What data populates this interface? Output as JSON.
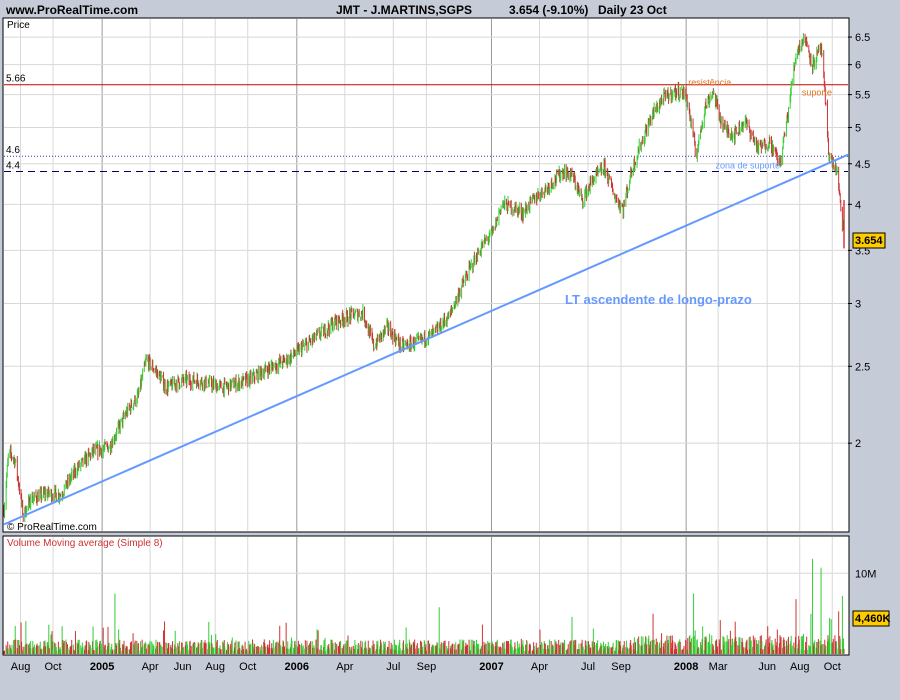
{
  "header": {
    "website": "www.ProRealTime.com",
    "instrument": "JMT - J.MARTINS,SGPS",
    "quote": "3.654 (-9.10%)",
    "period": "Daily 23 Oct"
  },
  "price_panel": {
    "axis_title": "Price",
    "watermark": "© ProRealTime.com",
    "last_price_badge": "3.654"
  },
  "volume_panel": {
    "title": "Volume Moving average (Simple 8)",
    "last_volume_badge": "4,460K"
  },
  "colors": {
    "up": "#33cc33",
    "down": "#cc3333",
    "trendline": "#6699ff",
    "resistance": "#cc0000",
    "support_dotted": "#3333cc",
    "support_dashed": "#000066",
    "annotation_orange": "#e07020"
  },
  "chart_data": [
    {
      "type": "candlestick",
      "scale": "log",
      "ylim": [
        1.55,
        6.85
      ],
      "y_ticks": [
        {
          "value": 6.5,
          "label": "6.5"
        },
        {
          "value": 6,
          "label": "6"
        },
        {
          "value": 5.5,
          "label": "5.5"
        },
        {
          "value": 5,
          "label": "5"
        },
        {
          "value": 4.5,
          "label": "4.5"
        },
        {
          "value": 4,
          "label": "4"
        },
        {
          "value": 3.5,
          "label": "3.5"
        },
        {
          "value": 3,
          "label": "3"
        },
        {
          "value": 2.5,
          "label": "2.5"
        },
        {
          "value": 2,
          "label": "2"
        }
      ],
      "xlim": [
        "2004-07-01",
        "2008-10-23"
      ],
      "x_ticks": [
        {
          "date": "2004-08-01",
          "label": "Aug",
          "major": false
        },
        {
          "date": "2004-10-01",
          "label": "Oct",
          "major": false
        },
        {
          "date": "2005-01-01",
          "label": "2005",
          "major": true
        },
        {
          "date": "2005-04-01",
          "label": "Apr",
          "major": false
        },
        {
          "date": "2005-06-01",
          "label": "Jun",
          "major": false
        },
        {
          "date": "2005-08-01",
          "label": "Aug",
          "major": false
        },
        {
          "date": "2005-10-01",
          "label": "Oct",
          "major": false
        },
        {
          "date": "2006-01-01",
          "label": "2006",
          "major": true
        },
        {
          "date": "2006-04-01",
          "label": "Apr",
          "major": false
        },
        {
          "date": "2006-07-01",
          "label": "Jul",
          "major": false
        },
        {
          "date": "2006-09-01",
          "label": "Sep",
          "major": false
        },
        {
          "date": "2007-01-01",
          "label": "2007",
          "major": true
        },
        {
          "date": "2007-04-01",
          "label": "Apr",
          "major": false
        },
        {
          "date": "2007-07-01",
          "label": "Jul",
          "major": false
        },
        {
          "date": "2007-09-01",
          "label": "Sep",
          "major": false
        },
        {
          "date": "2008-01-01",
          "label": "2008",
          "major": true
        },
        {
          "date": "2008-03-01",
          "label": "Mar",
          "major": false
        },
        {
          "date": "2008-06-01",
          "label": "Jun",
          "major": false
        },
        {
          "date": "2008-08-01",
          "label": "Aug",
          "major": false
        },
        {
          "date": "2008-10-01",
          "label": "Oct",
          "major": false
        }
      ],
      "close_path": [
        {
          "date": "2004-07-01",
          "close": 1.65
        },
        {
          "date": "2004-07-10",
          "close": 1.95
        },
        {
          "date": "2004-07-22",
          "close": 1.9
        },
        {
          "date": "2004-08-06",
          "close": 1.62
        },
        {
          "date": "2004-08-20",
          "close": 1.7
        },
        {
          "date": "2004-09-20",
          "close": 1.73
        },
        {
          "date": "2004-10-15",
          "close": 1.72
        },
        {
          "date": "2004-11-15",
          "close": 1.86
        },
        {
          "date": "2004-12-15",
          "close": 1.95
        },
        {
          "date": "2005-01-15",
          "close": 1.98
        },
        {
          "date": "2005-02-15",
          "close": 2.18
        },
        {
          "date": "2005-03-10",
          "close": 2.3
        },
        {
          "date": "2005-03-25",
          "close": 2.55
        },
        {
          "date": "2005-04-15",
          "close": 2.45
        },
        {
          "date": "2005-05-01",
          "close": 2.35
        },
        {
          "date": "2005-06-01",
          "close": 2.4
        },
        {
          "date": "2005-07-01",
          "close": 2.4
        },
        {
          "date": "2005-08-15",
          "close": 2.35
        },
        {
          "date": "2005-10-01",
          "close": 2.4
        },
        {
          "date": "2005-11-15",
          "close": 2.5
        },
        {
          "date": "2005-12-15",
          "close": 2.55
        },
        {
          "date": "2006-01-15",
          "close": 2.65
        },
        {
          "date": "2006-02-15",
          "close": 2.75
        },
        {
          "date": "2006-03-15",
          "close": 2.85
        },
        {
          "date": "2006-04-15",
          "close": 2.9
        },
        {
          "date": "2006-05-05",
          "close": 2.92
        },
        {
          "date": "2006-05-25",
          "close": 2.65
        },
        {
          "date": "2006-06-20",
          "close": 2.8
        },
        {
          "date": "2006-07-15",
          "close": 2.65
        },
        {
          "date": "2006-08-15",
          "close": 2.68
        },
        {
          "date": "2006-09-15",
          "close": 2.75
        },
        {
          "date": "2006-10-15",
          "close": 2.9
        },
        {
          "date": "2006-11-15",
          "close": 3.25
        },
        {
          "date": "2006-12-15",
          "close": 3.55
        },
        {
          "date": "2007-01-05",
          "close": 3.7
        },
        {
          "date": "2007-01-20",
          "close": 4.0
        },
        {
          "date": "2007-02-15",
          "close": 3.95
        },
        {
          "date": "2007-03-01",
          "close": 3.9
        },
        {
          "date": "2007-03-20",
          "close": 4.05
        },
        {
          "date": "2007-04-15",
          "close": 4.2
        },
        {
          "date": "2007-05-15",
          "close": 4.4
        },
        {
          "date": "2007-06-01",
          "close": 4.35
        },
        {
          "date": "2007-06-20",
          "close": 4.05
        },
        {
          "date": "2007-07-10",
          "close": 4.3
        },
        {
          "date": "2007-08-01",
          "close": 4.45
        },
        {
          "date": "2007-08-20",
          "close": 4.1
        },
        {
          "date": "2007-09-05",
          "close": 3.95
        },
        {
          "date": "2007-09-20",
          "close": 4.4
        },
        {
          "date": "2007-10-10",
          "close": 4.8
        },
        {
          "date": "2007-10-30",
          "close": 5.2
        },
        {
          "date": "2007-11-20",
          "close": 5.45
        },
        {
          "date": "2007-12-15",
          "close": 5.55
        },
        {
          "date": "2008-01-01",
          "close": 5.5
        },
        {
          "date": "2008-01-20",
          "close": 4.6
        },
        {
          "date": "2008-02-05",
          "close": 5.3
        },
        {
          "date": "2008-02-20",
          "close": 5.55
        },
        {
          "date": "2008-03-10",
          "close": 5.0
        },
        {
          "date": "2008-04-01",
          "close": 4.9
        },
        {
          "date": "2008-04-20",
          "close": 5.1
        },
        {
          "date": "2008-05-15",
          "close": 4.7
        },
        {
          "date": "2008-06-05",
          "close": 4.8
        },
        {
          "date": "2008-06-25",
          "close": 4.5
        },
        {
          "date": "2008-07-10",
          "close": 5.2
        },
        {
          "date": "2008-07-25",
          "close": 6.2
        },
        {
          "date": "2008-08-10",
          "close": 6.5
        },
        {
          "date": "2008-08-25",
          "close": 6.0
        },
        {
          "date": "2008-09-10",
          "close": 6.3
        },
        {
          "date": "2008-09-25",
          "close": 4.6
        },
        {
          "date": "2008-10-10",
          "close": 4.4
        },
        {
          "date": "2008-10-15",
          "close": 4.05
        },
        {
          "date": "2008-10-23",
          "close": 3.654
        }
      ],
      "horizontal_levels": [
        {
          "value": 5.66,
          "label": "5.66",
          "style": "solid",
          "color": "#cc0000"
        },
        {
          "value": 4.6,
          "label": "4.6",
          "style": "dotted",
          "color": "#3333cc"
        },
        {
          "value": 4.4,
          "label": "4.4",
          "style": "dashed",
          "color": "#000066"
        }
      ],
      "trendline": {
        "start": {
          "date": "2004-07-01",
          "value": 1.58
        },
        "end": {
          "date": "2008-10-23",
          "value": 4.62
        },
        "label": "LT ascendente de longo-prazo"
      },
      "annotations": [
        {
          "text": "resistência",
          "date": "2008-01-05",
          "value": 5.66,
          "color": "#e07020"
        },
        {
          "text": "suporte",
          "date": "2008-08-05",
          "value": 5.5,
          "color": "#e07020"
        },
        {
          "text": "zona de suporte",
          "date": "2008-02-25",
          "value": 4.45,
          "color": "#6699ff"
        }
      ],
      "last_value": 3.654
    },
    {
      "type": "bar",
      "title": "Volume Moving average (Simple 8)",
      "y_ticks": [
        {
          "value": 10000000,
          "label": "10M"
        }
      ],
      "ylim": [
        0,
        14500000
      ],
      "typical_volume": 1200000,
      "spikes": [
        {
          "date": "2005-01-25",
          "value": 7500000
        },
        {
          "date": "2006-09-25",
          "value": 5800000
        },
        {
          "date": "2007-06-01",
          "value": 4600000
        },
        {
          "date": "2008-01-15",
          "value": 7500000
        },
        {
          "date": "2008-03-05",
          "value": 4200000
        },
        {
          "date": "2008-07-25",
          "value": 6800000
        },
        {
          "date": "2008-08-25",
          "value": 11800000
        },
        {
          "date": "2008-09-10",
          "value": 10700000
        },
        {
          "date": "2008-10-20",
          "value": 7200000
        }
      ],
      "last_value": 4460000
    }
  ]
}
